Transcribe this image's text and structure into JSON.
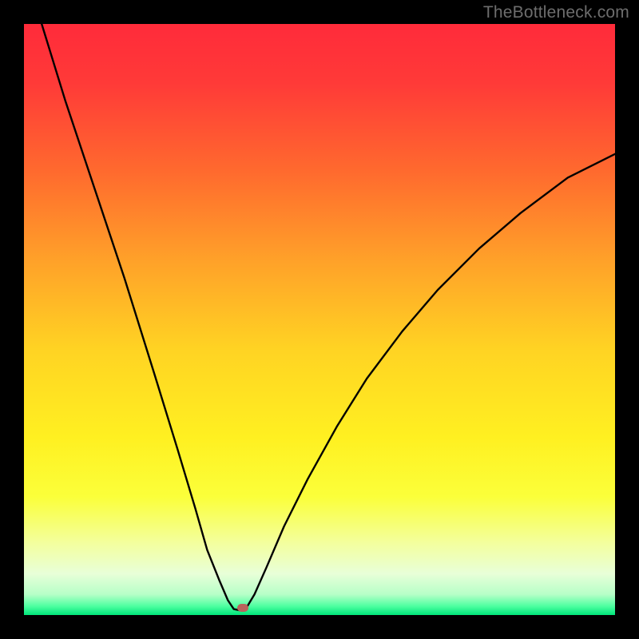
{
  "watermark": "TheBottleneck.com",
  "chart_data": {
    "type": "line",
    "title": "",
    "xlabel": "",
    "ylabel": "",
    "xlim": [
      0,
      100
    ],
    "ylim": [
      0,
      100
    ],
    "gradient_stops": [
      {
        "offset": 0.0,
        "color": "#ff2b3a"
      },
      {
        "offset": 0.1,
        "color": "#ff3a38"
      },
      {
        "offset": 0.25,
        "color": "#ff6a2e"
      },
      {
        "offset": 0.4,
        "color": "#ffa129"
      },
      {
        "offset": 0.55,
        "color": "#ffd323"
      },
      {
        "offset": 0.7,
        "color": "#fff021"
      },
      {
        "offset": 0.8,
        "color": "#fbff3a"
      },
      {
        "offset": 0.88,
        "color": "#f3ffa0"
      },
      {
        "offset": 0.93,
        "color": "#e8ffd8"
      },
      {
        "offset": 0.965,
        "color": "#b7ffc8"
      },
      {
        "offset": 0.985,
        "color": "#4dffa0"
      },
      {
        "offset": 1.0,
        "color": "#00e57a"
      }
    ],
    "series": [
      {
        "name": "left-branch",
        "x": [
          3,
          7,
          12,
          17,
          22,
          26,
          29,
          31,
          33,
          34.5,
          35.5
        ],
        "y": [
          100,
          87,
          72,
          57,
          41,
          28,
          18,
          11,
          6,
          2.5,
          1
        ]
      },
      {
        "name": "notch-floor",
        "x": [
          35.5,
          36.5,
          37.5
        ],
        "y": [
          1,
          0.8,
          1
        ]
      },
      {
        "name": "right-branch",
        "x": [
          37.5,
          39,
          41,
          44,
          48,
          53,
          58,
          64,
          70,
          77,
          84,
          92,
          100
        ],
        "y": [
          1,
          3.5,
          8,
          15,
          23,
          32,
          40,
          48,
          55,
          62,
          68,
          74,
          78
        ]
      }
    ],
    "marker": {
      "x": 37,
      "y": 1.2,
      "color": "#b9645c"
    }
  }
}
